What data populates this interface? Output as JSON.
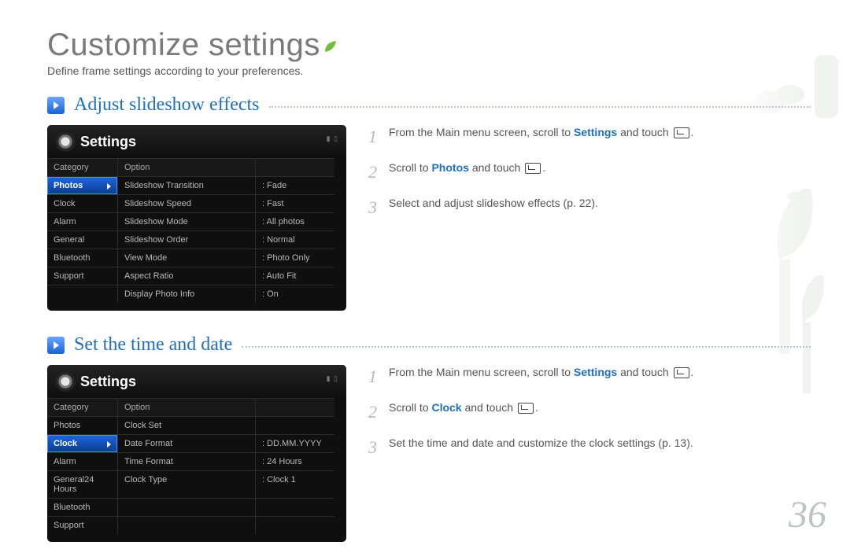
{
  "title": "Customize settings",
  "subtitle": "Define frame settings according to your preferences.",
  "page_number": "36",
  "sections": [
    {
      "heading": "Adjust slideshow effects",
      "panel": {
        "title": "Settings",
        "headers": [
          "Category",
          "Option"
        ],
        "categories": [
          "Photos",
          "Clock",
          "Alarm",
          "General",
          "Bluetooth",
          "Support"
        ],
        "selected_category_index": 0,
        "options": [
          {
            "label": "Slideshow Transition",
            "value": ": Fade"
          },
          {
            "label": "Slideshow Speed",
            "value": ": Fast"
          },
          {
            "label": "Slideshow Mode",
            "value": ": All photos"
          },
          {
            "label": "Slideshow Order",
            "value": ": Normal"
          },
          {
            "label": "View Mode",
            "value": ": Photo Only"
          },
          {
            "label": "Aspect Ratio",
            "value": ": Auto Fit"
          },
          {
            "label": "Display Photo Info",
            "value": ": On"
          }
        ]
      },
      "steps": [
        {
          "num": "1",
          "pre": "From the Main menu screen, scroll to",
          "bold": "Settings",
          "post": "and touch"
        },
        {
          "num": "2",
          "pre": "Scroll to",
          "bold": "Photos",
          "post": "and touch"
        },
        {
          "num": "3",
          "pre": "Select and adjust slideshow effects (p. 22)."
        }
      ]
    },
    {
      "heading": "Set the time and date",
      "panel": {
        "title": "Settings",
        "headers": [
          "Category",
          "Option"
        ],
        "categories": [
          "Photos",
          "Clock",
          "Alarm",
          "General24 Hours",
          "Bluetooth",
          "Support"
        ],
        "selected_category_index": 1,
        "options": [
          {
            "label": "Clock Set",
            "value": ""
          },
          {
            "label": "Date Format",
            "value": ": DD.MM.YYYY"
          },
          {
            "label": "Time Format",
            "value": ": 24 Hours"
          },
          {
            "label": "Clock Type",
            "value": ": Clock 1"
          }
        ]
      },
      "steps": [
        {
          "num": "1",
          "pre": "From the Main menu screen, scroll to",
          "bold": "Settings",
          "post": "and touch"
        },
        {
          "num": "2",
          "pre": "Scroll to",
          "bold": "Clock",
          "post": "and touch"
        },
        {
          "num": "3",
          "pre": "Set the time and date and customize the clock settings (p. 13)."
        }
      ]
    }
  ]
}
